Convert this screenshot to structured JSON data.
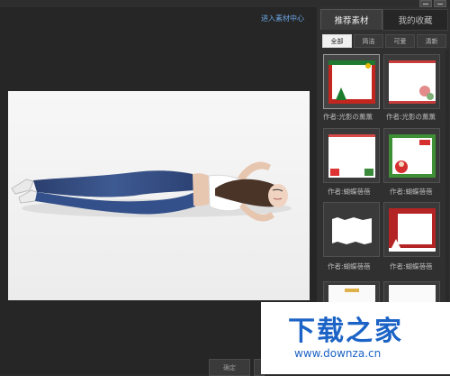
{
  "header": {
    "link_text": "进入素材中心"
  },
  "panel": {
    "tabs": [
      {
        "label": "推荐素材",
        "active": true
      },
      {
        "label": "我的收藏",
        "active": false
      }
    ],
    "subtabs": [
      {
        "label": "全部",
        "active": true
      },
      {
        "label": "简洁",
        "active": false
      },
      {
        "label": "可爱",
        "active": false
      },
      {
        "label": "清新",
        "active": false
      }
    ],
    "thumbnails": [
      {
        "author": "作者:光影の薰薰",
        "theme": "christmas-tree-frame",
        "selected": true
      },
      {
        "author": "作者:光影の薰薰",
        "theme": "floral-frame",
        "selected": false
      },
      {
        "author": "作者:蝴蝶蓓蓓",
        "theme": "gift-frame",
        "selected": false
      },
      {
        "author": "作者:蝴蝶蓓蓓",
        "theme": "santa-frame",
        "selected": false
      },
      {
        "author": "作者:蝴蝶蓓蓓",
        "theme": "torn-paper-frame",
        "selected": false
      },
      {
        "author": "作者:蝴蝶蓓蓓",
        "theme": "red-village-frame",
        "selected": false
      }
    ]
  },
  "footer": {
    "confirm_label": "确定"
  },
  "watermark": {
    "logo": "下载之家",
    "url": "www.downza.cn"
  },
  "colors": {
    "link": "#6aa3e0",
    "watermark": "#1b63c6",
    "panel_bg": "#303030",
    "work_bg": "#262626"
  }
}
